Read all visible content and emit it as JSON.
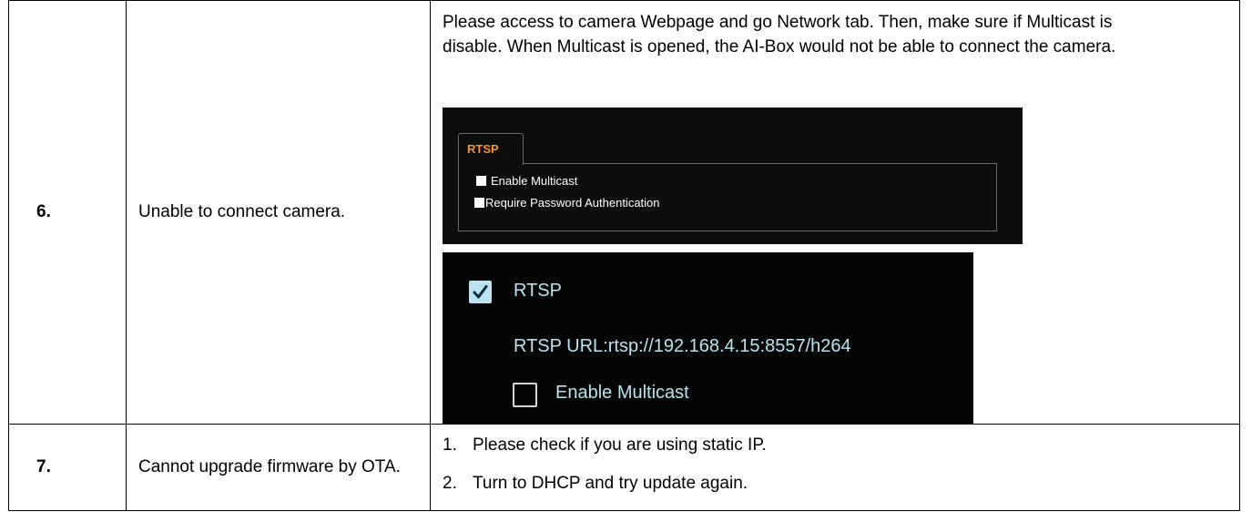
{
  "rows": [
    {
      "number": "6.",
      "issue": "Unable to connect camera.",
      "solution_text": "Please access to camera Webpage and go Network tab. Then, make sure if Multicast is disable. When Multicast is opened, the AI-Box would not be able to connect the camera.",
      "screenshot1": {
        "tab_label": "RTSP",
        "options": [
          "Enable Multicast",
          "Require Password Authentication"
        ]
      },
      "screenshot2": {
        "rtsp_label": "RTSP",
        "rtsp_url": "RTSP URL:rtsp://192.168.4.15:8557/h264",
        "multicast_label": "Enable Multicast"
      }
    },
    {
      "number": "7.",
      "issue": "Cannot upgrade firmware by OTA.",
      "steps": [
        {
          "num": "1.",
          "text": "Please check if you are using static IP."
        },
        {
          "num": "2.",
          "text": "Turn to DHCP and try update again."
        }
      ]
    }
  ],
  "colors": {
    "tab_accent": "#f7941d",
    "cyan_text": "#b8e3ef",
    "panel_bg": "#0d0d0d"
  }
}
